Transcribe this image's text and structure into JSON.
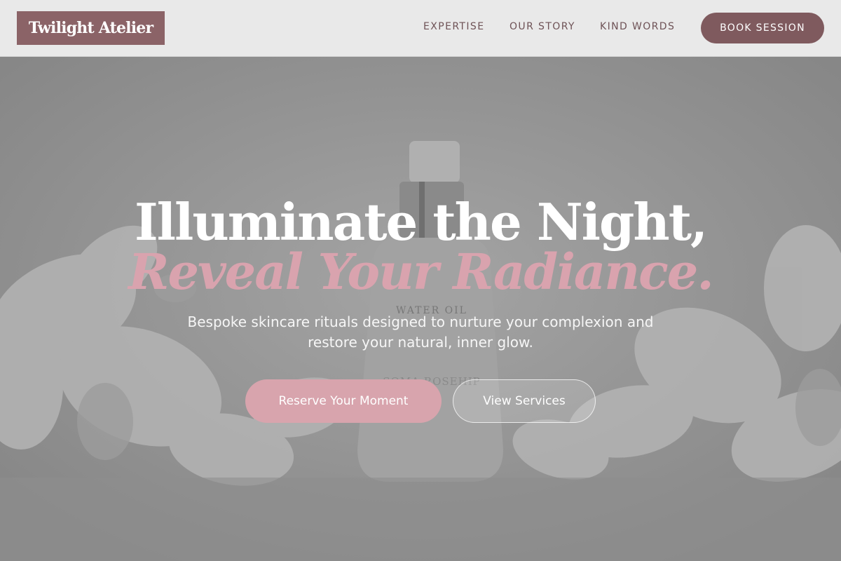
{
  "brand": {
    "name": "Twilight Atelier"
  },
  "nav": {
    "items": [
      {
        "label": "EXPERTISE"
      },
      {
        "label": "OUR STORY"
      },
      {
        "label": "KIND WORDS"
      }
    ],
    "book_label": "BOOK SESSION"
  },
  "hero": {
    "headline": "Illuminate the Night,",
    "headline_accent": "Reveal Your Radiance.",
    "subtext": "Bespoke skincare rituals designed to nurture your complexion and restore your natural, inner glow.",
    "primary_cta": "Reserve Your Moment",
    "secondary_cta": "View Services",
    "background_image": {
      "depicts": "serum bottle among white orchids",
      "bottle_text": [
        "WATER OIL",
        "SOMA ROSEHIP"
      ]
    }
  },
  "colors": {
    "brand": "#8b6367",
    "book_button": "#7f5a5e",
    "accent_pink": "#d9a3ae",
    "header_bg": "#e9e9e9",
    "nav_text": "#6e5256"
  }
}
